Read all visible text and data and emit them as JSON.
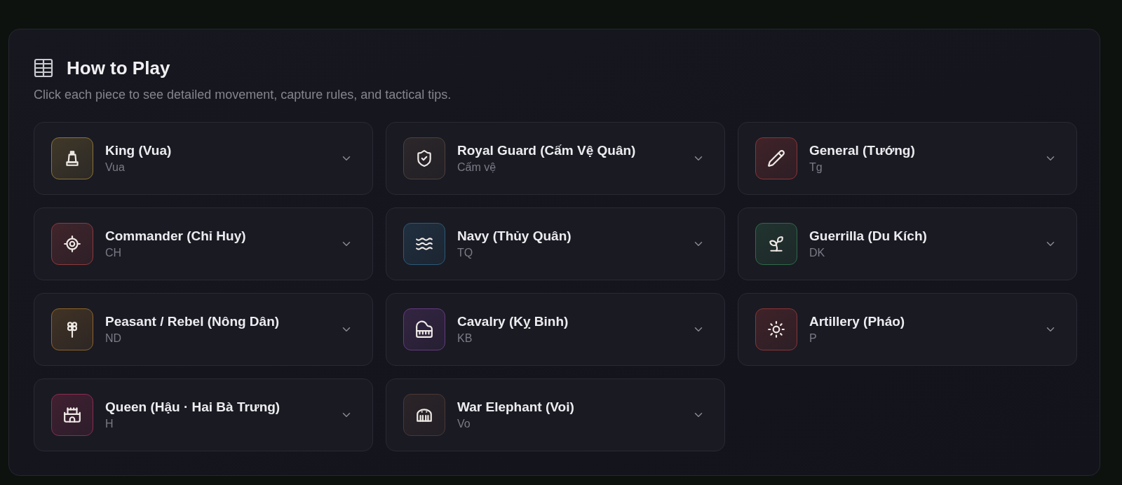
{
  "panel": {
    "title": "How to Play",
    "subtitle": "Click each piece to see detailed movement, capture rules, and tactical tips."
  },
  "pieces": [
    {
      "kind": "king",
      "name": "King (Vua)",
      "abbr": "Vua",
      "color": "#8a7434"
    },
    {
      "kind": "royal_guard",
      "name": "Royal Guard (Cấm Vệ Quân)",
      "abbr": "Cấm vệ",
      "color": "#4e4139"
    },
    {
      "kind": "general",
      "name": "General (Tướng)",
      "abbr": "Tg",
      "color": "#8c3434"
    },
    {
      "kind": "commander",
      "name": "Commander (Chỉ Huy)",
      "abbr": "CH",
      "color": "#8e3a3c"
    },
    {
      "kind": "navy",
      "name": "Navy (Thủy Quân)",
      "abbr": "TQ",
      "color": "#2b5a78"
    },
    {
      "kind": "guerrilla",
      "name": "Guerrilla (Du Kích)",
      "abbr": "DK",
      "color": "#2f6a47"
    },
    {
      "kind": "peasant",
      "name": "Peasant / Rebel (Nông Dân)",
      "abbr": "ND",
      "color": "#8e6428"
    },
    {
      "kind": "cavalry",
      "name": "Cavalry (Kỵ Binh)",
      "abbr": "KB",
      "color": "#643a80"
    },
    {
      "kind": "artillery",
      "name": "Artillery (Pháo)",
      "abbr": "P",
      "color": "#8a3434"
    },
    {
      "kind": "queen",
      "name": "Queen (Hậu · Hai Bà Trưng)",
      "abbr": "H",
      "color": "#8c2c4e"
    },
    {
      "kind": "elephant",
      "name": "War Elephant (Voi)",
      "abbr": "Vo",
      "color": "#4c3833"
    }
  ]
}
